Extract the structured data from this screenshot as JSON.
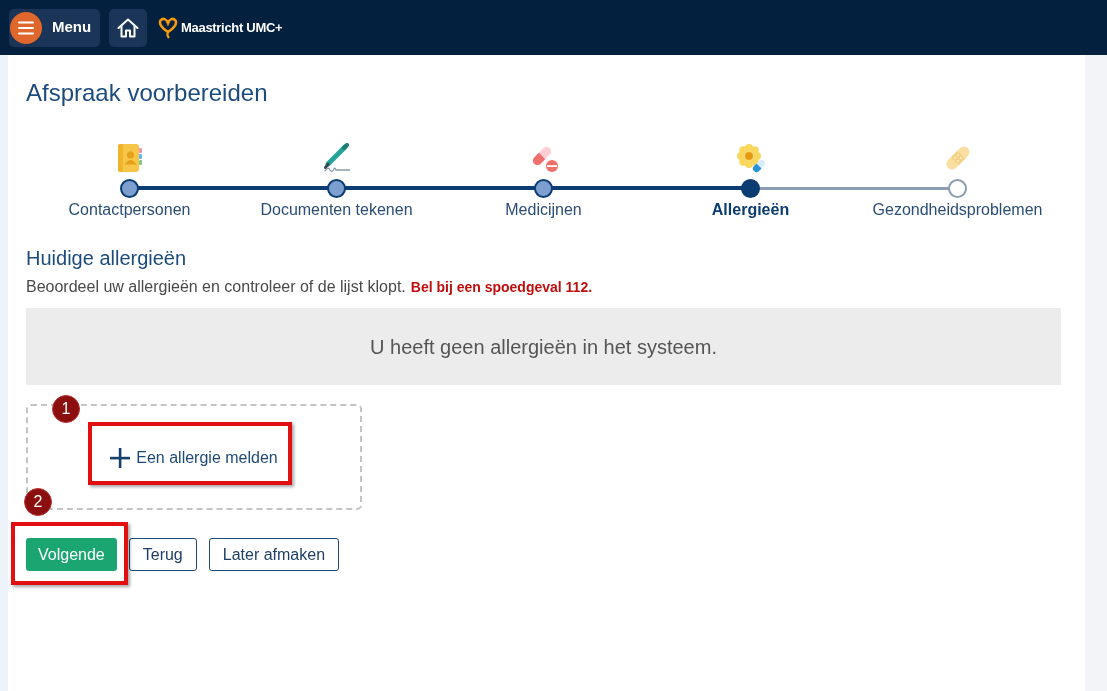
{
  "header": {
    "menu_button": {
      "label": "Menu"
    },
    "logo_text": "Maastricht UMC+"
  },
  "page": {
    "title": "Afspraak voorbereiden"
  },
  "steps": [
    {
      "label": "Contactpersonen",
      "completed": true,
      "selected": false
    },
    {
      "label": "Documenten tekenen",
      "completed": true,
      "selected": false
    },
    {
      "label": "Medicijnen",
      "completed": true,
      "selected": false
    },
    {
      "label": "Allergieën",
      "completed": false,
      "selected": true
    },
    {
      "label": "Gezondheidsproblemen",
      "completed": false,
      "selected": false
    }
  ],
  "section": {
    "heading": "Huidige allergieën",
    "instruction": "Beoordeel uw allergieën en controleer of de lijst klopt.",
    "emergency_note": "Bel bij een spoedgeval 112.",
    "empty_message": "U heeft geen allergieën in het systeem.",
    "add_button": {
      "label": "Een allergie melden"
    }
  },
  "buttons": [
    {
      "label": "Volgende",
      "kind": "primary"
    },
    {
      "label": "Terug",
      "kind": "secondary"
    },
    {
      "label": "Later afmaken",
      "kind": "secondary"
    }
  ],
  "annotations": [
    {
      "label": "1"
    },
    {
      "label": "2"
    }
  ]
}
